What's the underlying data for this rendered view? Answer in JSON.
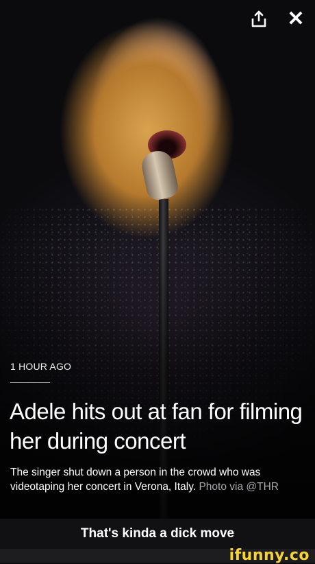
{
  "story": {
    "timestamp": "1 HOUR AGO",
    "headline": "Adele hits out at fan for filming her during concert",
    "summary": "The singer shut down a person in the crowd who was videotaping her concert in Verona, Italy.",
    "credit": "Photo via @THR"
  },
  "toolbar": {
    "share_icon": "share-icon",
    "close_icon": "close-icon",
    "close_glyph": "✕"
  },
  "caption": "That's kinda a dick move",
  "watermark": "ifunny.co",
  "colors": {
    "watermark": "#f7d238",
    "caption_bar": "#111114",
    "credit_text": "#a9a9b0"
  }
}
